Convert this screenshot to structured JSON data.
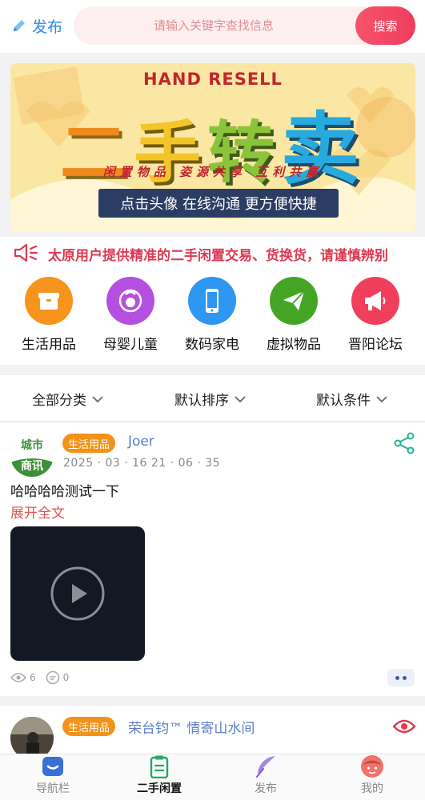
{
  "header": {
    "publish_label": "发布",
    "search_placeholder": "请输入关键字查找信息",
    "search_button": "搜索"
  },
  "banner": {
    "title_en": "HAND RESELL",
    "title_cn_chars": [
      "二",
      "手",
      "转",
      "卖"
    ],
    "tagline": "闲置物品 姿源共享 互利共赢",
    "ribbon": "点击头像 在线沟通 更方便快捷"
  },
  "notice": {
    "text": "太原用户提供精准的二手闲置交易、货换货，请谨慎辨别"
  },
  "categories": [
    {
      "label": "生活用品",
      "color": "#f7941d",
      "icon": "box-icon"
    },
    {
      "label": "母婴儿童",
      "color": "#b54fe0",
      "icon": "baby-icon"
    },
    {
      "label": "数码家电",
      "color": "#2d97f2",
      "icon": "phone-icon"
    },
    {
      "label": "虚拟物品",
      "color": "#44a525",
      "icon": "send-icon"
    },
    {
      "label": "晋阳论坛",
      "color": "#ef3f5a",
      "icon": "megaphone-icon"
    }
  ],
  "filters": {
    "category": "全部分类",
    "sort": "默认排序",
    "condition": "默认条件"
  },
  "posts": [
    {
      "badge": "生活用品",
      "author": "Joer",
      "time": "2025 · 03 · 16  21 · 06 · 35",
      "avatar_text_top": "城市",
      "avatar_text_bottom": "商讯",
      "content": "哈哈哈哈测试一下",
      "expand": "展开全文",
      "views": "6",
      "comments": "0"
    },
    {
      "badge": "生活用品",
      "author": "荣台钧™ 情寄山水间"
    }
  ],
  "tabbar": {
    "items": [
      {
        "label": "导航栏",
        "icon": "chat-bubble-icon"
      },
      {
        "label": "二手闲置",
        "icon": "clipboard-icon"
      },
      {
        "label": "发布",
        "icon": "feather-icon"
      },
      {
        "label": "我的",
        "icon": "face-icon"
      }
    ]
  },
  "colors": {
    "accent": "#ef3d5d",
    "link": "#2c8bea",
    "badge": "#f39218"
  }
}
